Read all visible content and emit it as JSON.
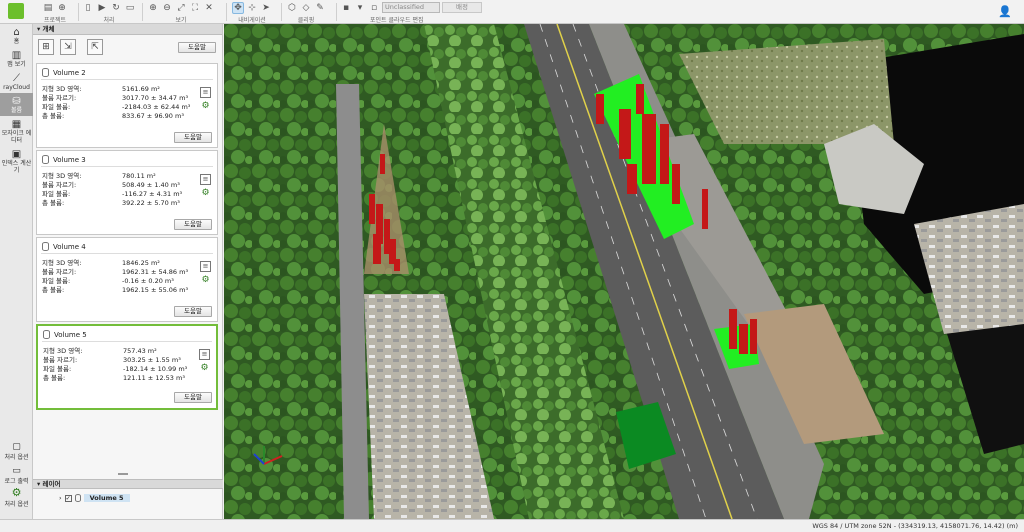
{
  "toolbar": {
    "groups": [
      {
        "label": "프로젝트"
      },
      {
        "label": "처리"
      },
      {
        "label": "보기"
      },
      {
        "label": "내비게이션"
      },
      {
        "label": "클리핑"
      },
      {
        "label": "포인트 클라우드 편집"
      }
    ],
    "point_cloud_select": "Unclassified",
    "apply_label": "배정"
  },
  "nav": {
    "items": [
      {
        "label": "홈",
        "icon": "home-icon"
      },
      {
        "label": "맵 보기",
        "icon": "map-icon"
      },
      {
        "label": "rayCloud",
        "icon": "raycloud-icon"
      },
      {
        "label": "볼륨",
        "icon": "volume-icon"
      },
      {
        "label": "모자이크 에디터",
        "icon": "mosaic-icon"
      },
      {
        "label": "인덱스 계산기",
        "icon": "calculator-icon"
      }
    ],
    "bottom": [
      {
        "label": "처리 옵션",
        "icon": "processing-options-icon"
      },
      {
        "label": "로그 출력",
        "icon": "log-icon"
      },
      {
        "label": "처리 옵션",
        "icon": "gear-icon"
      }
    ]
  },
  "panel": {
    "title": "개체",
    "help_label": "도움말",
    "volumes": [
      {
        "name": "Volume 2",
        "terrain": "5161.69 m²",
        "cut": "3017.70 ± 34.47 m³",
        "fill": "-2184.03 ± 62.44 m³",
        "total": "833.67 ± 96.90 m³"
      },
      {
        "name": "Volume 3",
        "terrain": "780.11 m²",
        "cut": "508.49 ± 1.40 m³",
        "fill": "-116.27 ± 4.31 m³",
        "total": "392.22 ± 5.70 m³"
      },
      {
        "name": "Volume 4",
        "terrain": "1846.25 m²",
        "cut": "1962.31 ± 54.86 m³",
        "fill": "-0.16 ± 0.20 m³",
        "total": "1962.15 ± 55.06 m³"
      },
      {
        "name": "Volume 5",
        "terrain": "757.43 m²",
        "cut": "303.25 ± 1.55 m³",
        "fill": "-182.14 ± 10.99 m³",
        "total": "121.11 ± 12.53 m³"
      }
    ],
    "labels": {
      "terrain": "지형 3D 영역:",
      "cut": "볼륨 자르기:",
      "fill": "파일 볼륨:",
      "total": "총 볼륨:"
    },
    "layers_title": "레이어",
    "layer_selected": "Volume 5"
  },
  "status": {
    "text": "WGS 84 / UTM zone 52N - (334319.13, 4158071.76, 14.42) (m)"
  },
  "colors": {
    "accent_green": "#73bd3a",
    "volume_fill_green": "#22ee22",
    "volume_cut_red": "#d01c1c",
    "selected_volume": "#0b8a22"
  }
}
